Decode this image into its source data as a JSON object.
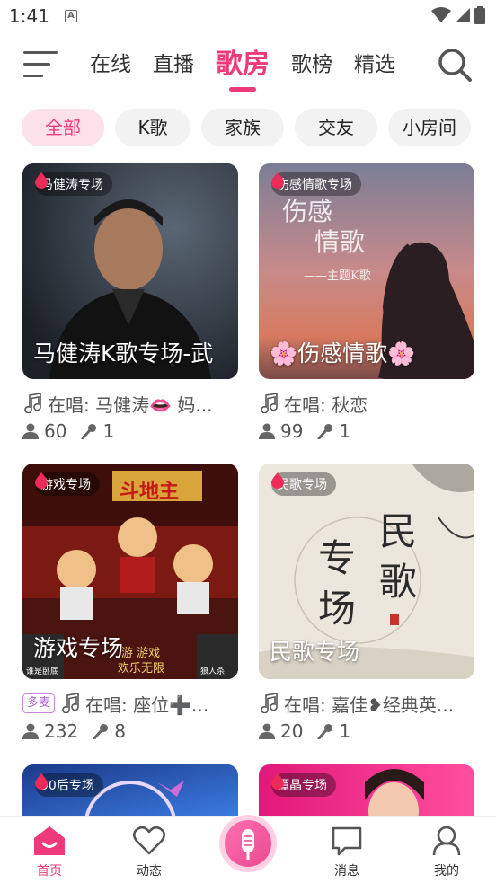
{
  "status": {
    "time": "1:41",
    "notification_icon": "A"
  },
  "top_nav": {
    "tabs": [
      {
        "label": "在线"
      },
      {
        "label": "直播"
      },
      {
        "label": "歌房",
        "active": true
      },
      {
        "label": "歌榜"
      },
      {
        "label": "精选"
      }
    ]
  },
  "chips": [
    {
      "label": "全部",
      "active": true
    },
    {
      "label": "K歌"
    },
    {
      "label": "家族"
    },
    {
      "label": "交友"
    },
    {
      "label": "小房间"
    }
  ],
  "rooms": [
    {
      "tag": "马健涛专场",
      "title": "马健涛K歌专场-武",
      "singing": "在唱: 马健涛👄 妈...",
      "listeners": "60",
      "mics": "1",
      "badge": ""
    },
    {
      "tag": "伤感情歌专场",
      "title": "🌸伤感情歌🌸",
      "singing": "在唱: 秋恋",
      "listeners": "99",
      "mics": "1",
      "badge": "",
      "cover_text": {
        "line1": "伤感",
        "line2": "情歌",
        "line3": "——主题K歌"
      }
    },
    {
      "tag": "游戏专场",
      "title": "游戏专场",
      "singing": "在唱: 座位➕...",
      "listeners": "232",
      "mics": "8",
      "badge": "多麦",
      "cover_text": {
        "banner": "斗地主",
        "left": "谁是卧底",
        "center1": "游  游戏",
        "center2": "欢乐无限",
        "right": "狼人杀"
      }
    },
    {
      "tag": "民歌专场",
      "title": "民歌专场",
      "singing": "在唱: 嘉佳❥经典英...",
      "listeners": "20",
      "mics": "1",
      "badge": "",
      "cover_text": {
        "big1": "民",
        "big2": "歌",
        "big3": "专",
        "big4": "场"
      }
    },
    {
      "tag": "90后专场"
    },
    {
      "tag": "谭晶专场"
    }
  ],
  "bottom_nav": [
    {
      "label": "首页",
      "icon": "home-icon",
      "active": true
    },
    {
      "label": "动态",
      "icon": "heart-icon"
    },
    {
      "label": "",
      "icon": "mic-icon"
    },
    {
      "label": "消息",
      "icon": "chat-icon"
    },
    {
      "label": "我的",
      "icon": "user-icon"
    }
  ],
  "colors": {
    "accent": "#ee3a7a",
    "chip_active_bg": "#fce1ea",
    "chip_bg": "#f2f2f2"
  }
}
